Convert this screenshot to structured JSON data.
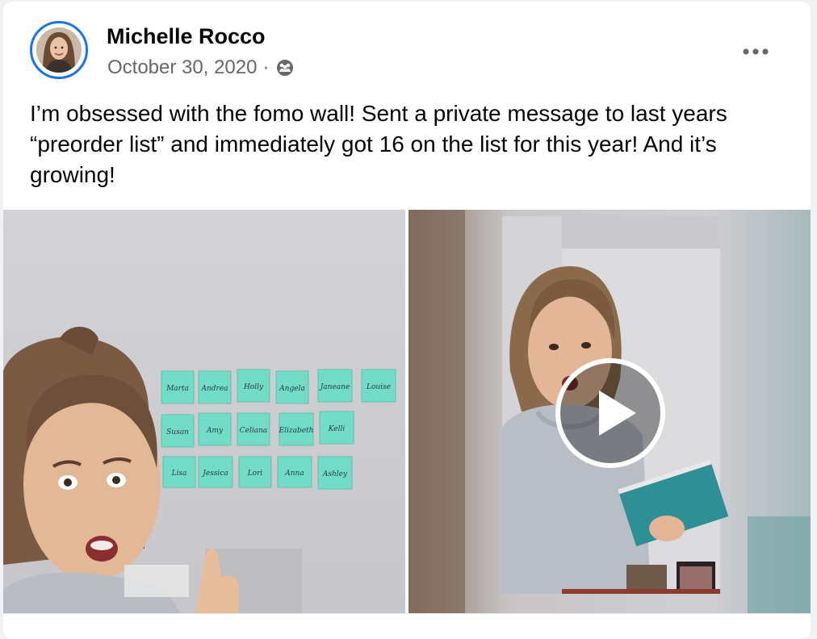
{
  "post": {
    "author": "Michelle Rocco",
    "date": "October 30, 2020",
    "separator": "·",
    "audience_icon": "groups-icon",
    "more_icon": "more-options-icon",
    "text": "I’m obsessed with the fomo wall! Sent a private message to last years “preorder list” and immediately got 16 on the list for this year! And it’s growing!"
  },
  "media": {
    "left_photo": {
      "kind": "photo",
      "sticky_notes": [
        [
          "Marta",
          "Andrea",
          "Holly",
          "Angela",
          "Janeane",
          "Louise"
        ],
        [
          "Susan",
          "Amy",
          "Celiana",
          "Elizabeth",
          "Kelli"
        ],
        [
          "Lisa",
          "Jessica",
          "Lori",
          "Anna",
          "Ashley"
        ]
      ]
    },
    "right_video": {
      "kind": "video",
      "play_icon": "play-icon"
    }
  },
  "colors": {
    "avatar_ring": "#1b74e4",
    "text_primary": "#050505",
    "text_secondary": "#65676b",
    "sticky_note": "#6fe3c8",
    "wall": "#d6d6da"
  }
}
